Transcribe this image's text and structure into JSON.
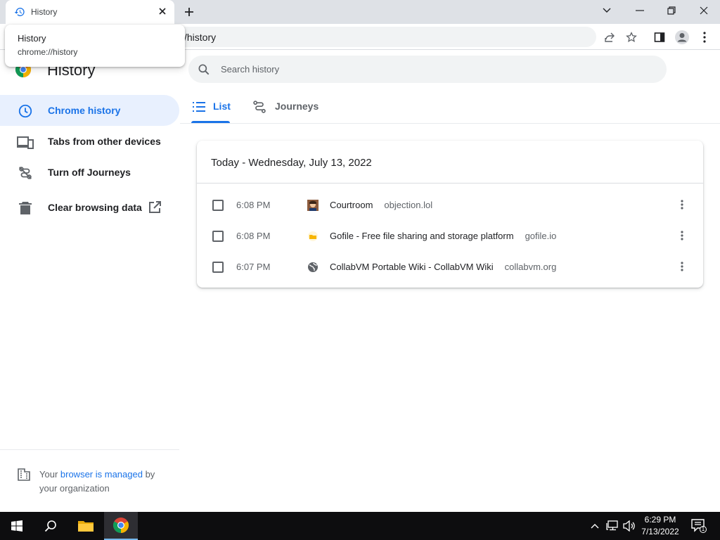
{
  "browser": {
    "tab": {
      "title": "History",
      "close_symbol": "✕"
    },
    "new_tab_symbol": "+",
    "hover_card": {
      "title": "History",
      "url": "chrome://history"
    },
    "omnibox": {
      "url_visible": "/history"
    }
  },
  "page": {
    "title": "History",
    "search": {
      "placeholder": "Search history",
      "value": ""
    }
  },
  "sidebar": {
    "items": [
      {
        "label": "Chrome history",
        "icon": "clock-icon",
        "active": true
      },
      {
        "label": "Tabs from other devices",
        "icon": "devices-icon"
      },
      {
        "label": "Turn off Journeys",
        "icon": "journeys-off-icon"
      },
      {
        "label": "Clear browsing data",
        "icon": "trash-icon"
      }
    ],
    "managed": {
      "prefix": "Your ",
      "link": "browser is managed",
      "suffix": " by your organization"
    }
  },
  "tabs": [
    {
      "label": "List",
      "icon": "list-icon",
      "active": true
    },
    {
      "label": "Journeys",
      "icon": "journeys-icon"
    }
  ],
  "history": {
    "date_header": "Today - Wednesday, July 13, 2022",
    "entries": [
      {
        "time": "6:08 PM",
        "title": "Courtroom",
        "domain": "objection.lol",
        "favicon": "courtroom-favicon"
      },
      {
        "time": "6:08 PM",
        "title": "Gofile - Free file sharing and storage platform",
        "domain": "gofile.io",
        "favicon": "gofile-favicon"
      },
      {
        "time": "6:07 PM",
        "title": "CollabVM Portable Wiki - CollabVM Wiki",
        "domain": "collabvm.org",
        "favicon": "globe-favicon"
      }
    ]
  },
  "taskbar": {
    "clock": {
      "time": "6:29 PM",
      "date": "7/13/2022"
    },
    "notification_count": "1"
  },
  "colors": {
    "accent": "#1a73e8",
    "active_bg": "#e8f0fe",
    "tabstrip": "#dee1e6",
    "taskbar": "#0d0d0f"
  }
}
